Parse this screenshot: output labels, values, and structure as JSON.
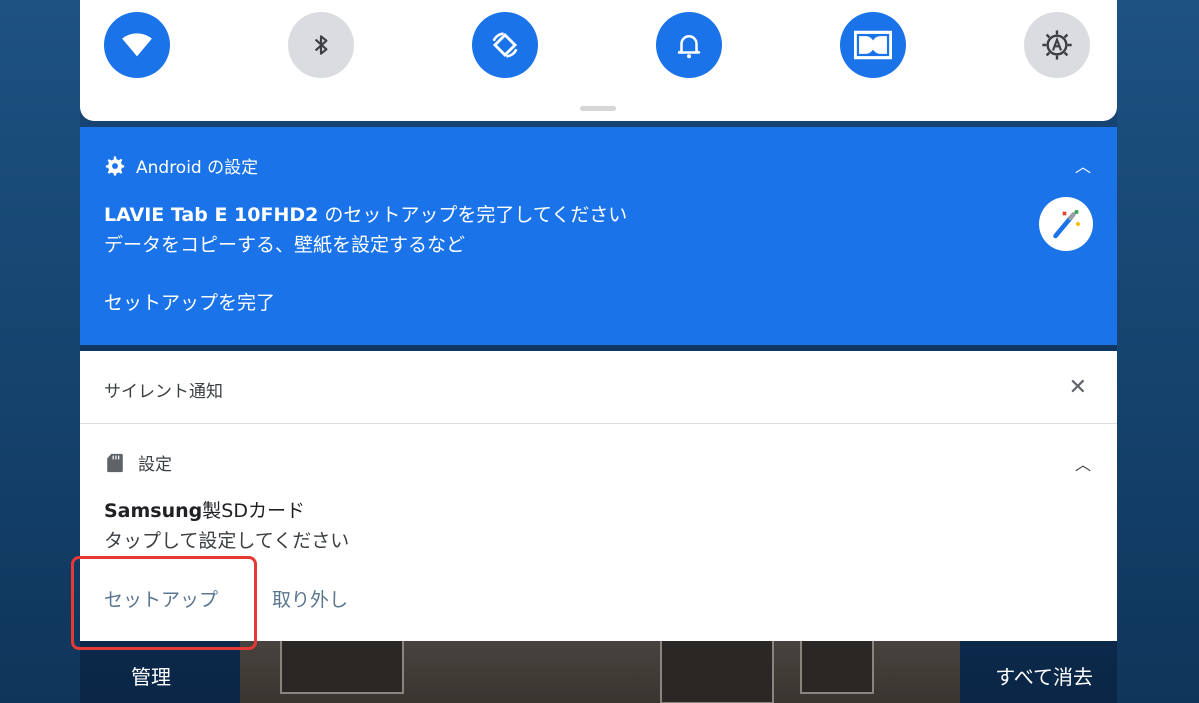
{
  "quick_settings": {
    "tiles": [
      {
        "name": "wifi-icon",
        "state": "on"
      },
      {
        "name": "bluetooth-icon",
        "state": "off"
      },
      {
        "name": "auto-rotate-icon",
        "state": "on"
      },
      {
        "name": "notification-bell-icon",
        "state": "on"
      },
      {
        "name": "dolby-icon",
        "state": "on"
      },
      {
        "name": "auto-brightness-icon",
        "state": "off"
      }
    ]
  },
  "setup_notification": {
    "app_name": "Android の設定",
    "title_bold": "LAVIE Tab E 10FHD2",
    "title_rest": " のセットアップを完了してください",
    "text": "データをコピーする、壁紙を設定するなど",
    "action": "セットアップを完了"
  },
  "silent_section": {
    "title": "サイレント通知",
    "close": "✕",
    "notification": {
      "app_name": "設定",
      "title_bold": "Samsung",
      "title_rest": "製SDカード",
      "text": "タップして設定してください",
      "actions": [
        "セットアップ",
        "取り外し"
      ]
    }
  },
  "footer": {
    "manage": "管理",
    "clear_all": "すべて消去"
  },
  "colors": {
    "accent": "#1a73e8",
    "highlight": "#e53935"
  }
}
